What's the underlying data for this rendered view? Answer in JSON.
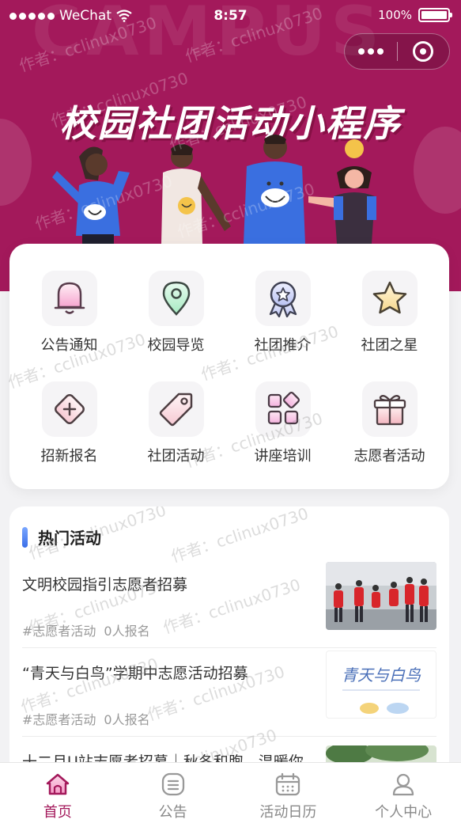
{
  "status_bar": {
    "carrier": "WeChat",
    "time": "8:57",
    "battery": "100%"
  },
  "banner": {
    "title": "校园社团活动小程序",
    "bg_text": "CAMPUS"
  },
  "menu": [
    {
      "label": "公告通知",
      "icon": "bell-icon"
    },
    {
      "label": "校园导览",
      "icon": "map-pin-icon"
    },
    {
      "label": "社团推介",
      "icon": "award-badge-icon"
    },
    {
      "label": "社团之星",
      "icon": "star-icon"
    },
    {
      "label": "招新报名",
      "icon": "diamond-plus-icon"
    },
    {
      "label": "社团活动",
      "icon": "tag-icon"
    },
    {
      "label": "讲座培训",
      "icon": "grid-apps-icon"
    },
    {
      "label": "志愿者活动",
      "icon": "gift-icon"
    }
  ],
  "hot": {
    "title": "热门活动",
    "items": [
      {
        "name": "文明校园指引志愿者招募",
        "category": "#志愿者活动",
        "signups": "0人报名"
      },
      {
        "name": "“青天与白鸟”学期中志愿活动招募",
        "category": "#志愿者活动",
        "signups": "0人报名",
        "thumb_text": "青天与白鸟"
      },
      {
        "name": "十二月U站志愿者招募｜秋冬和煦，温暖你"
      }
    ]
  },
  "tabs": [
    {
      "label": "首页",
      "icon": "home-icon",
      "active": true
    },
    {
      "label": "公告",
      "icon": "notice-icon",
      "active": false
    },
    {
      "label": "活动日历",
      "icon": "calendar-icon",
      "active": false
    },
    {
      "label": "个人中心",
      "icon": "user-icon",
      "active": false
    }
  ],
  "watermark": "作者：cclinux0730",
  "colors": {
    "brand": "#a3195b",
    "background": "#f2f2f4"
  }
}
